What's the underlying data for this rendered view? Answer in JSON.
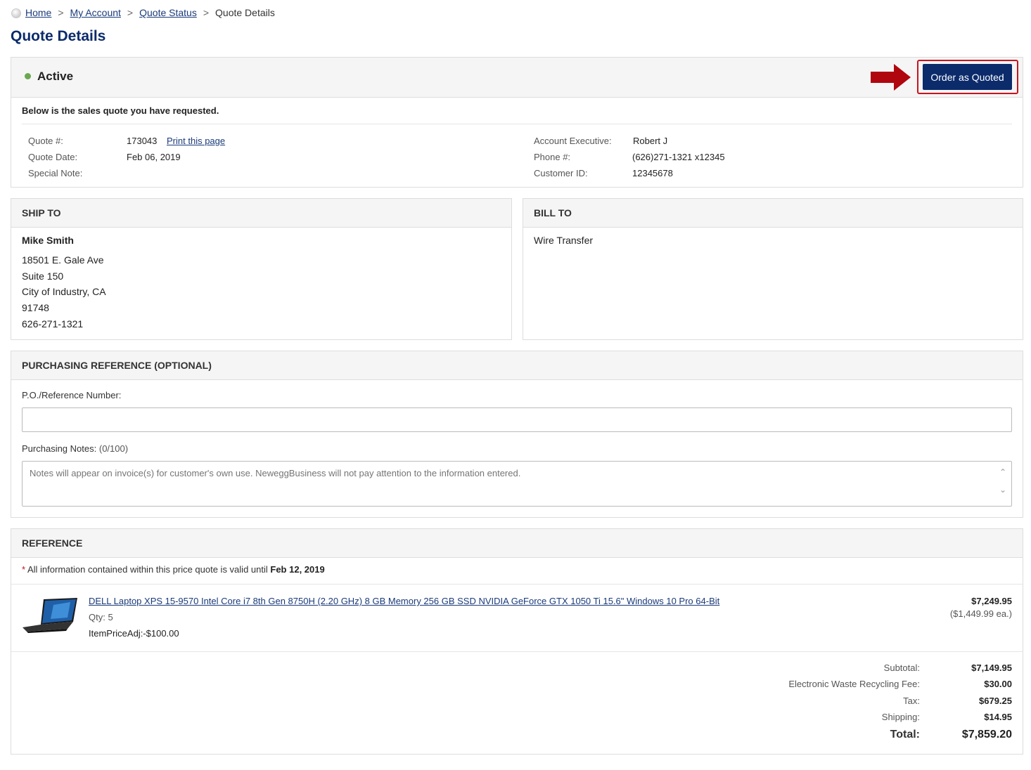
{
  "breadcrumb": {
    "home": "Home",
    "account": "My Account",
    "status": "Quote Status",
    "current": "Quote Details",
    "separator": ">"
  },
  "page_title": "Quote Details",
  "status": {
    "label": "Active",
    "color": "#6aa84f",
    "order_button": "Order as Quoted",
    "intro": "Below is the sales quote you have requested."
  },
  "quote": {
    "number_label": "Quote #:",
    "number": "173043",
    "print_link": "Print this page",
    "date_label": "Quote Date:",
    "date": "Feb 06, 2019",
    "note_label": "Special Note:",
    "note": "",
    "exec_label": "Account Executive:",
    "exec": "Robert J",
    "phone_label": "Phone #:",
    "phone": "(626)271-1321 x12345",
    "customer_label": "Customer ID:",
    "customer": "12345678"
  },
  "ship_to": {
    "title": "SHIP TO",
    "name": "Mike Smith",
    "street": "18501 E. Gale Ave",
    "suite": "Suite 150",
    "city": "City of Industry, CA",
    "zip": "91748",
    "phone": "626-271-1321"
  },
  "bill_to": {
    "title": "BILL TO",
    "method": "Wire Transfer"
  },
  "purchasing": {
    "title": "PURCHASING REFERENCE (OPTIONAL)",
    "po_label": "P.O./Reference Number:",
    "po_value": "",
    "notes_label": "Purchasing Notes:",
    "notes_count": "(0/100)",
    "notes_placeholder": "Notes will appear on invoice(s) for customer's own use. NeweggBusiness will not pay attention to the information entered."
  },
  "reference": {
    "title": "REFERENCE",
    "valid_star": "*",
    "valid_text": "All information contained within this price quote is valid until",
    "valid_date": "Feb 12, 2019",
    "item": {
      "name": "DELL Laptop XPS 15-9570 Intel Core i7 8th Gen 8750H (2.20 GHz) 8 GB Memory 256 GB SSD NVIDIA GeForce GTX 1050 Ti 15.6\" Windows 10 Pro 64-Bit",
      "qty": "Qty: 5",
      "adj": "ItemPriceAdj:-$100.00",
      "price": "$7,249.95",
      "each": "($1,449.99 ea.)"
    },
    "summary": {
      "subtotal_label": "Subtotal:",
      "subtotal": "$7,149.95",
      "ewaste_label": "Electronic Waste Recycling Fee:",
      "ewaste": "$30.00",
      "tax_label": "Tax:",
      "tax": "$679.25",
      "shipping_label": "Shipping:",
      "shipping": "$14.95",
      "total_label": "Total:",
      "total": "$7,859.20"
    }
  }
}
